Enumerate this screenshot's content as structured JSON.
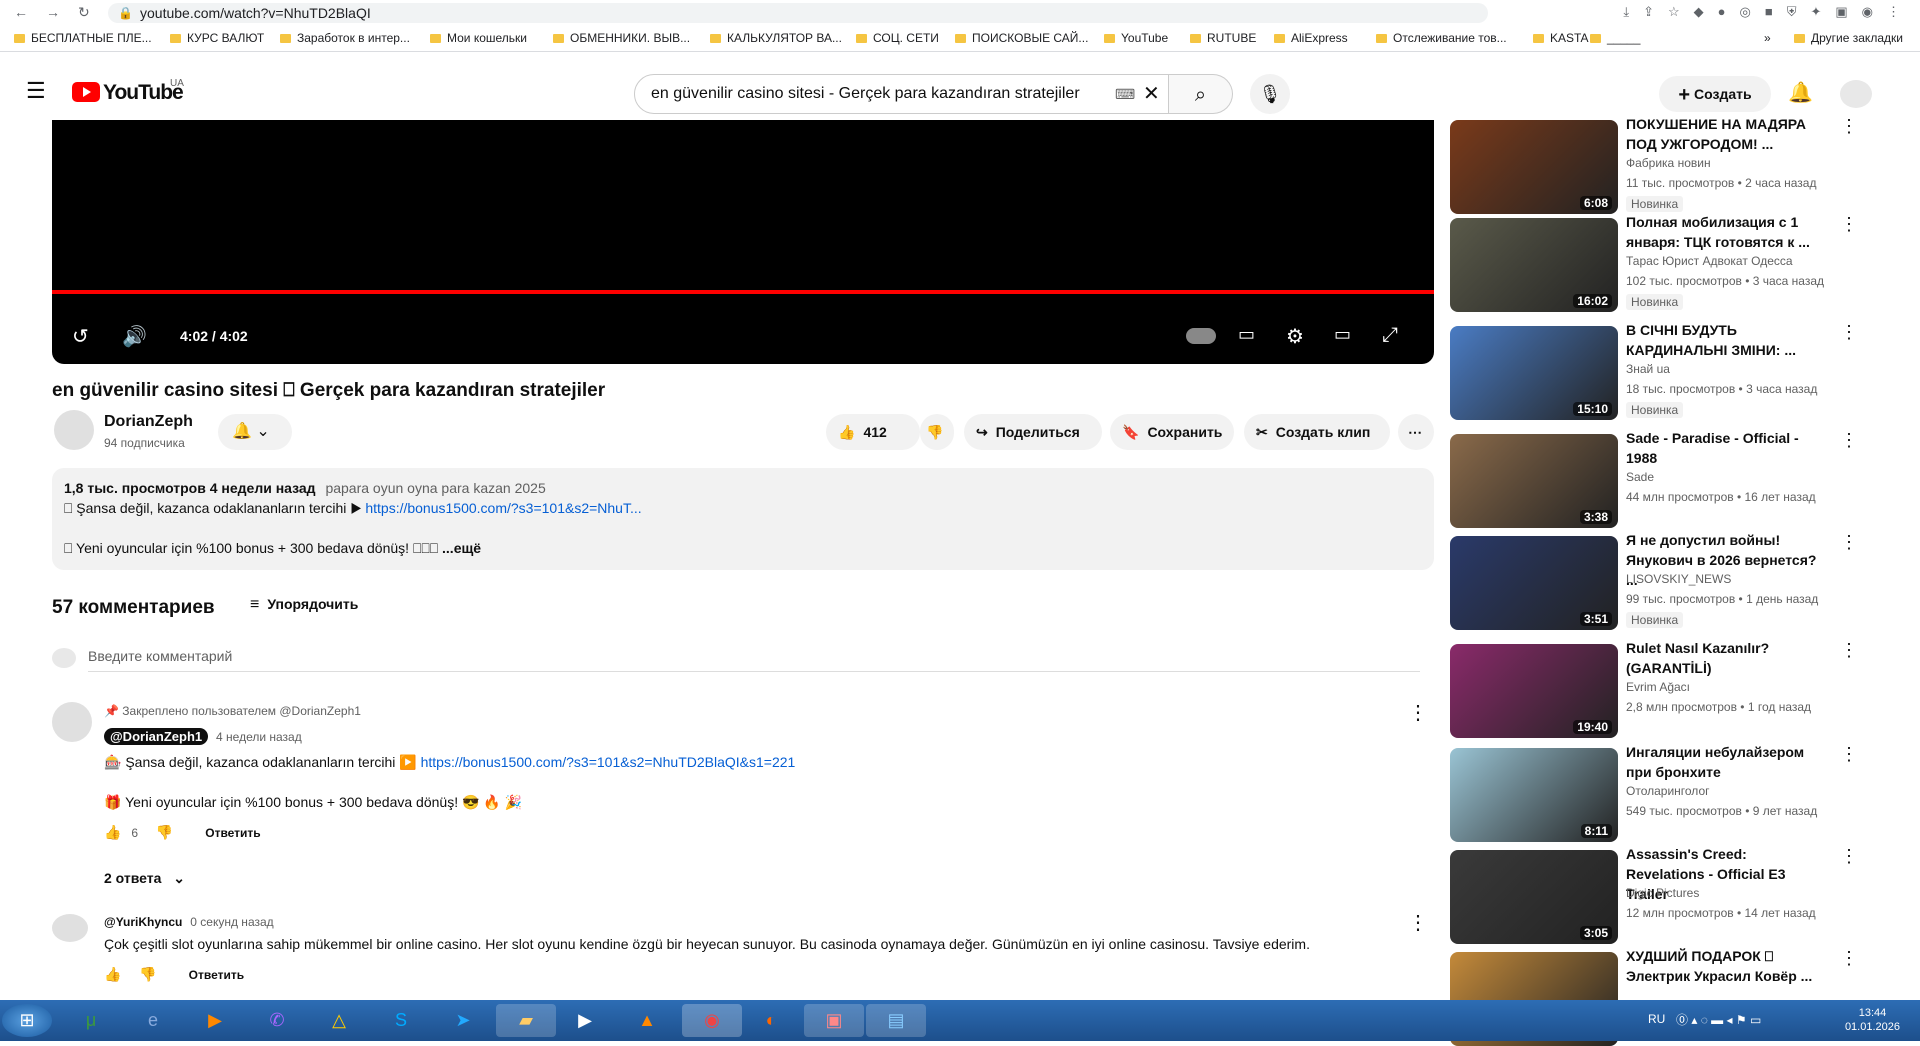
{
  "browser": {
    "url": "youtube.com/watch?v=NhuTD2BlaQI",
    "bookmarks": [
      "БЕСПЛАТНЫЕ ПЛЕ...",
      "КУРС ВАЛЮТ",
      "Заработок в интер...",
      "Мои кошельки",
      "ОБМЕННИКИ. ВЫВ...",
      "КАЛЬКУЛЯТОР ВА...",
      "СОЦ. СЕТИ",
      "ПОИСКОВЫЕ САЙ...",
      "YouTube",
      "RUTUBE",
      "AliExpress",
      "Отслеживание тов...",
      "KASTA",
      "_____"
    ],
    "other_bookmarks": "Другие закладки"
  },
  "header": {
    "logo": "YouTube",
    "region": "UA",
    "search_value": "en güvenilir casino sitesi - Gerçek para kazandıran stratejiler",
    "create_label": "Создать"
  },
  "player": {
    "time": "4:02 / 4:02",
    "progress_fraction": 1.0
  },
  "video": {
    "title": "en güvenilir casino sitesi ⎕ Gerçek para kazandıran stratejiler",
    "channel": "DorianZeph",
    "subs": "94 подписчика",
    "likes": "412",
    "share": "Поделиться",
    "save": "Сохранить",
    "clip": "Создать клип",
    "desc_stats": "1,8 тыс. просмотров  4 недели назад",
    "desc_tags": "papara oyun oyna para kazan 2025",
    "desc_line1": "⎕ Şansa değil, kazanca odaklananların tercihi ▶ ",
    "desc_link": "https://bonus1500.com/?s3=101&s2=NhuT...",
    "desc_line2": "⎕ Yeni oyuncular için %100 bonus + 300 bedava dönüş! ⎕⎕⎕ ",
    "desc_more": "...ещё"
  },
  "comments": {
    "count": "57 комментариев",
    "sort": "Упорядочить",
    "placeholder": "Введите комментарий",
    "pinned_note": "Закреплено пользователем @DorianZeph1",
    "c1_author": "@DorianZeph1",
    "c1_time": "4 недели назад",
    "c1_line1": "🎰 Şansa değil, kazanca odaklananların tercihi ▶️ ",
    "c1_link": "https://bonus1500.com/?s3=101&s2=NhuTD2BlaQI&s1=221",
    "c1_line2": "🎁 Yeni oyuncular için %100 bonus + 300 bedava dönüş! 😎 🔥 🎉",
    "c1_likes": "6",
    "reply": "Ответить",
    "replies": "2 ответа",
    "c2_author": "@YuriKhyncu",
    "c2_time": "0 секунд назад",
    "c2_text": "Çok çeşitli slot oyunlarına sahip mükemmel bir online casino. Her slot oyunu kendine özgü bir heyecan sunuyor. Bu casinoda oynamaya değer. Günümüzün en iyi online casinosu. Tavsiye ederim."
  },
  "related": [
    {
      "title": "ПОКУШЕНИЕ НА МАДЯРА ПОД УЖГОРОДОМ! ...",
      "channel": "Фабрика новин",
      "meta": "11 тыс. просмотров • 2 часа назад",
      "badge": "Новинка",
      "duration": "6:08",
      "color": "#7a3a1a"
    },
    {
      "title": "Полная мобилизация с 1 января: ТЦК готовятся к ...",
      "channel": "Тарас Юрист Адвокат Одесса",
      "meta": "102 тыс. просмотров • 3 часа назад",
      "badge": "Новинка",
      "duration": "16:02",
      "color": "#5a5a4a"
    },
    {
      "title": "В СІЧНІ БУДУТЬ КАРДИНАЛЬНІ ЗМІНИ: ...",
      "channel": "Знай ua",
      "meta": "18 тыс. просмотров • 3 часа назад",
      "badge": "Новинка",
      "duration": "15:10",
      "color": "#4a7cc4"
    },
    {
      "title": "Sade - Paradise - Official - 1988",
      "channel": "Sade",
      "meta": "44 млн просмотров • 16 лет назад",
      "badge": "",
      "duration": "3:38",
      "color": "#8a6a4a"
    },
    {
      "title": "Я не допустил войны! Янукович в 2026 вернется? ...",
      "channel": "LISOVSKIY_NEWS",
      "meta": "99 тыс. просмотров • 1 день назад",
      "badge": "Новинка",
      "duration": "3:51",
      "color": "#2a3a6a"
    },
    {
      "title": "Rulet Nasıl Kazanılır? (GARANTİLİ)",
      "channel": "Evrim Ağacı",
      "meta": "2,8 млн просмотров • 1 год назад",
      "badge": "",
      "duration": "19:40",
      "color": "#8a2a6a"
    },
    {
      "title": "Ингаляции небулайзером при бронхите",
      "channel": "Отоларинголог",
      "meta": "549 тыс. просмотров • 9 лет назад",
      "badge": "",
      "duration": "8:11",
      "color": "#9ac4d4"
    },
    {
      "title": "Assassin's Creed: Revelations - Official E3 Trailer",
      "channel": "Digic Pictures",
      "meta": "12 млн просмотров • 14 лет назад",
      "badge": "",
      "duration": "3:05",
      "color": "#3a3a3a"
    },
    {
      "title": "ХУДШИЙ ПОДАРОК ⎕ Электрик Украсил Ковёр ...",
      "channel": "",
      "meta": "",
      "badge": "",
      "duration": "",
      "color": "#c48a3a"
    }
  ],
  "taskbar": {
    "lang": "RU",
    "time": "13:44",
    "date": "01.01.2026"
  }
}
